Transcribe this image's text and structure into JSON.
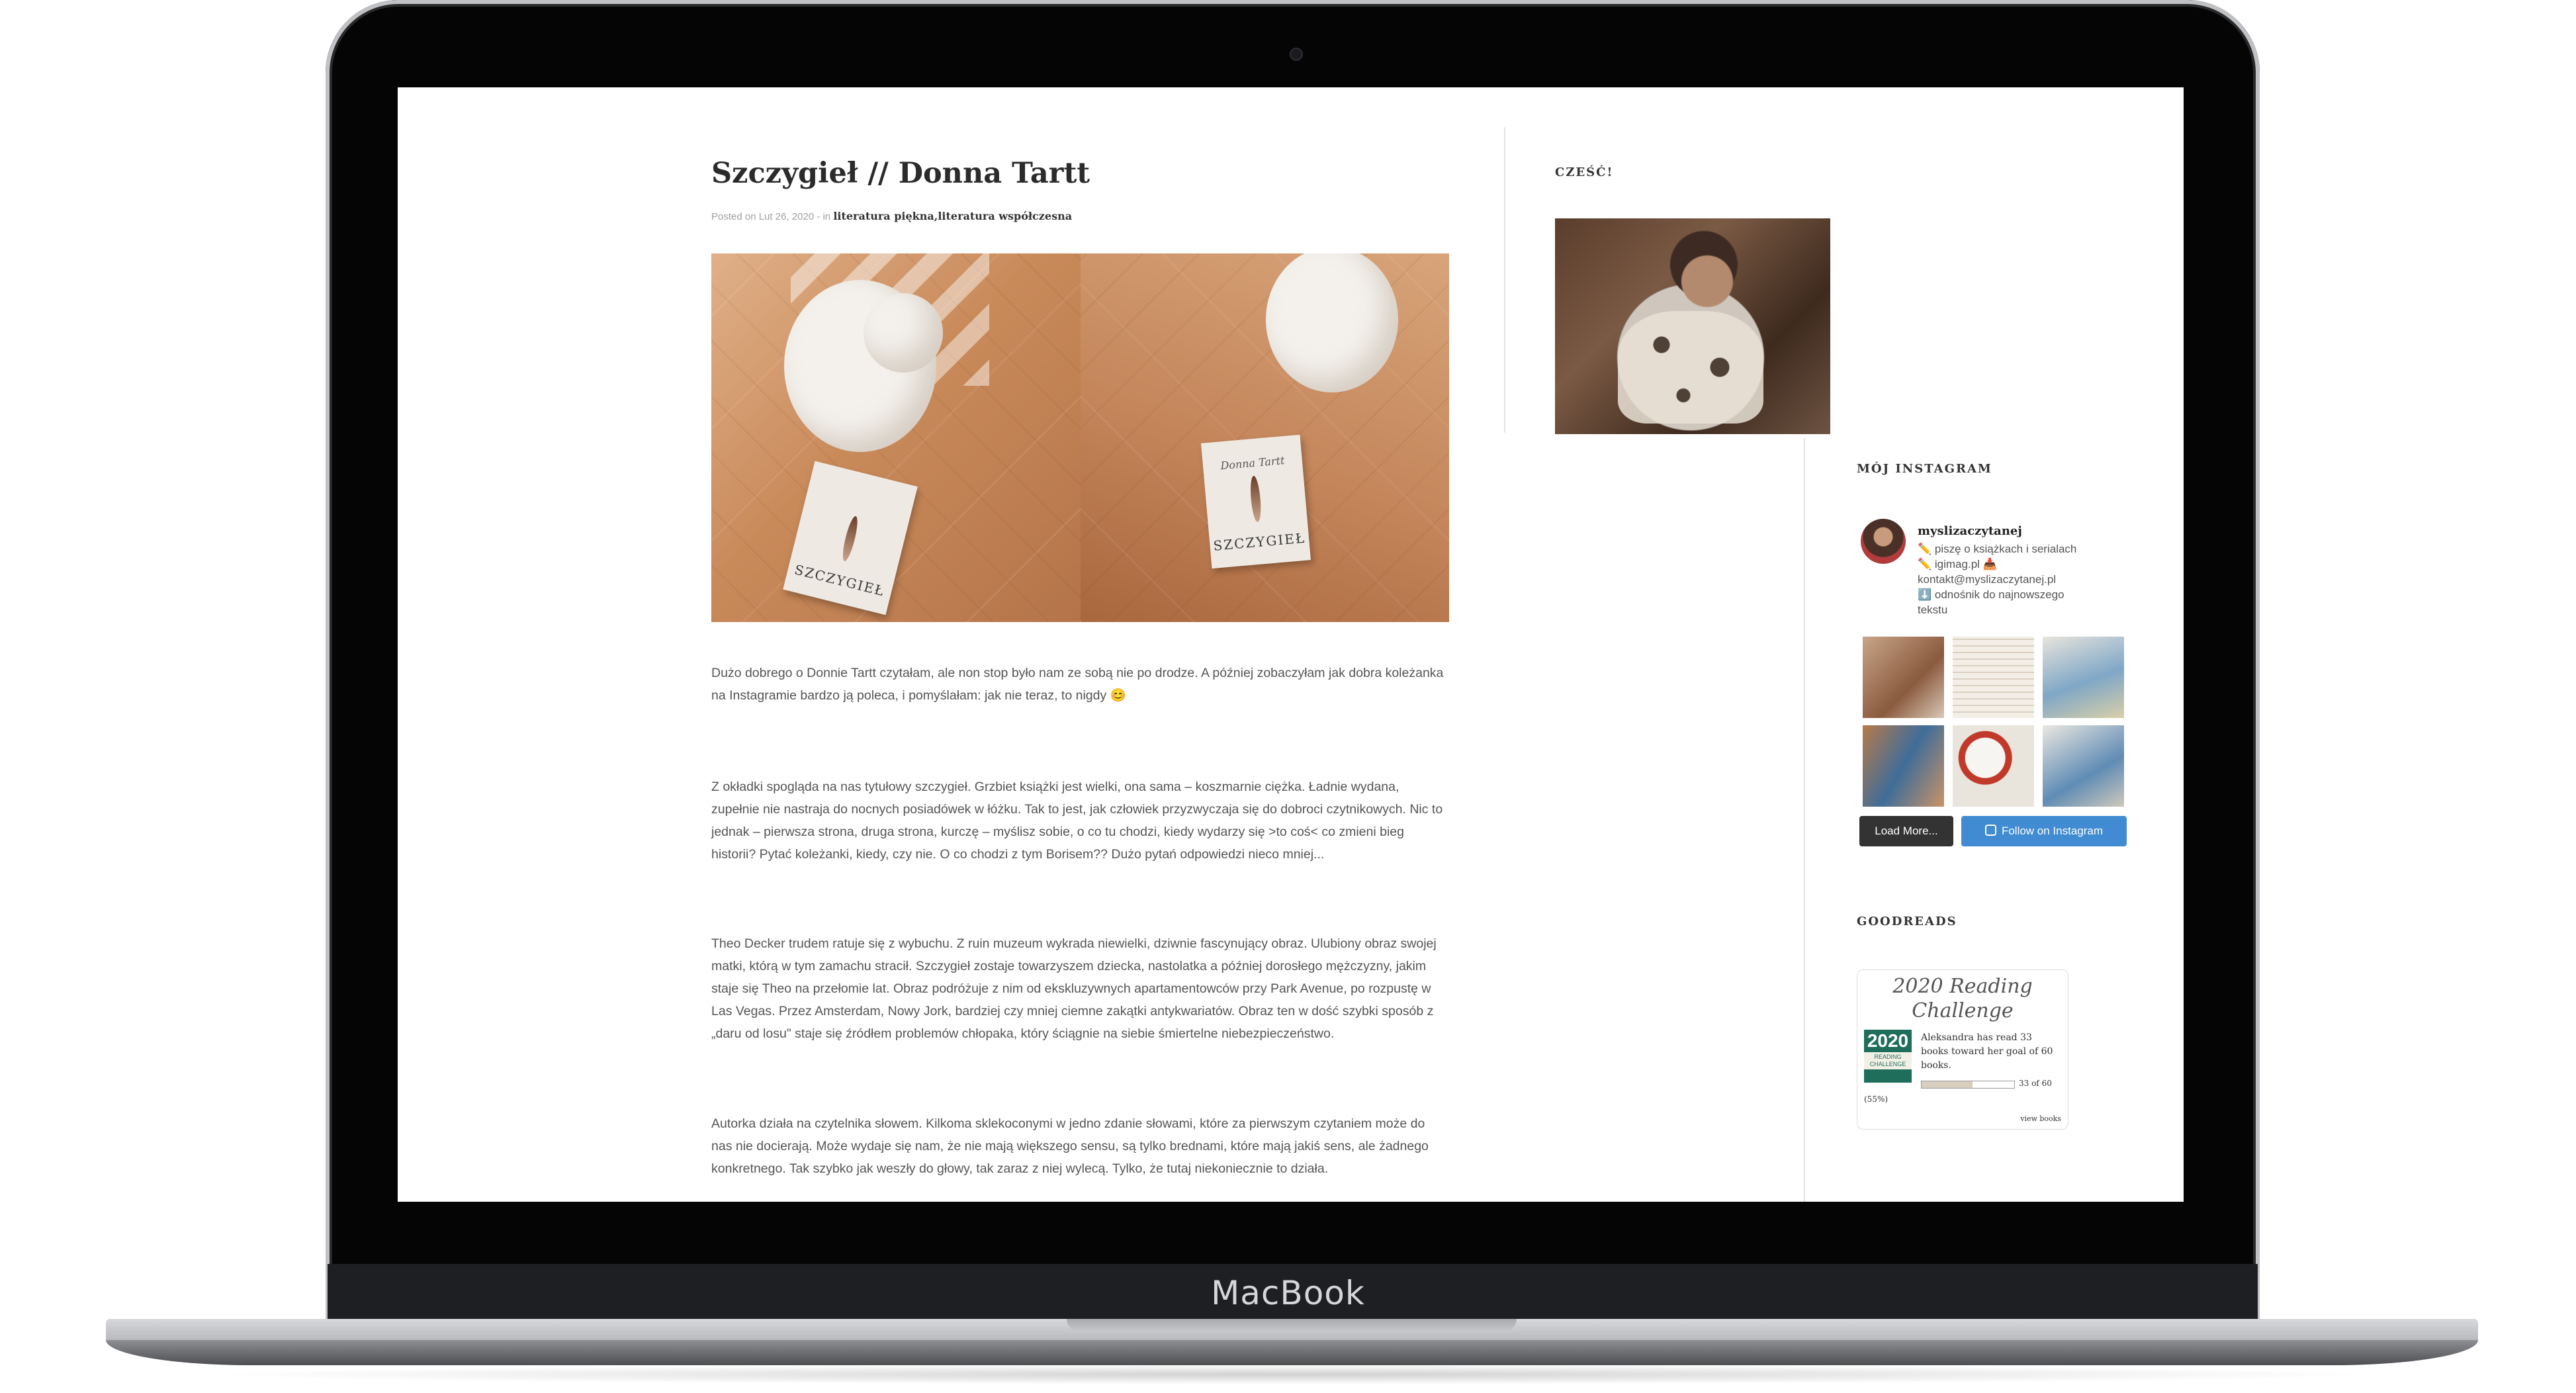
{
  "device": {
    "brand": "MacBook"
  },
  "post": {
    "title": "Szczygieł // Donna Tartt",
    "meta_prefix": "Posted on Lut 26, 2020 - in",
    "categories": [
      "literatura piękna",
      "literatura współczesna"
    ],
    "image_book_title": "SZCZYGIEŁ",
    "image_book_author": "Donna Tartt",
    "paragraphs": [
      "Dużo dobrego o Donnie Tartt czytałam, ale non stop było nam ze sobą nie po drodze. A później zobaczyłam jak dobra koleżanka na Instagramie bardzo ją poleca, i pomyślałam: jak nie teraz, to nigdy 😊",
      "Z okładki spogląda na nas tytułowy szczygieł. Grzbiet książki jest wielki, ona sama – koszmarnie ciężka. Ładnie wydana, zupełnie nie nastraja do nocnych posiadówek w łóżku. Tak to jest, jak człowiek przyzwyczaja się do dobroci czytnikowych. Nic to jednak – pierwsza strona, druga strona, kurczę – myślisz sobie, o co tu chodzi, kiedy wydarzy się >to coś< co zmieni bieg historii? Pytać koleżanki, kiedy, czy nie. O co chodzi z tym Borisem?? Dużo pytań odpowiedzi nieco mniej...",
      "Theo Decker trudem ratuje się z wybuchu. Z ruin muzeum wykrada niewielki, dziwnie fascynujący obraz. Ulubiony obraz swojej matki, którą w tym zamachu stracił. Szczygieł zostaje towarzyszem dziecka, nastolatka a później dorosłego mężczyzny, jakim staje się Theo na przełomie lat. Obraz podróżuje z nim od ekskluzywnych apartamentowców przy Park Avenue, po rozpustę w Las Vegas. Przez Amsterdam, Nowy Jork, bardziej czy mniej ciemne zakątki antykwariatów. Obraz ten w dość szybki sposób z „daru od losu\" staje się źródłem problemów chłopaka, który ściągnie na siebie śmiertelne niebezpieczeństwo.",
      "Autorka działa na czytelnika słowem. Kilkoma sklekoconymi w jedno zdanie słowami, które za pierwszym czytaniem może do nas nie docierają. Może wydaje się nam, że nie mają większego sensu, są tylko brednami, które mają jakiś sens, ale żadnego konkretnego. Tak szybko jak weszły do głowy, tak zaraz z niej wylecą. Tylko, że tutaj niekoniecznie to działa."
    ]
  },
  "sidebar": {
    "hello_heading": "CZEŚĆ!",
    "instagram": {
      "heading": "MÓJ INSTAGRAM",
      "username": "myslizaczytanej",
      "bio_lines": [
        "✏️ piszę o książkach i serialach",
        "✏️ igimag.pl 📥",
        "kontakt@myslizaczytanej.pl",
        "⬇️ odnośnik do najnowszego",
        "tekstu"
      ],
      "load_more_label": "Load More...",
      "follow_label": "Follow on Instagram",
      "load_more_color": "#333333",
      "follow_color": "#408bd1"
    },
    "goodreads": {
      "heading": "GOODREADS",
      "challenge_title": "2020 Reading Challenge",
      "badge_year": "2020",
      "badge_text": "READING CHALLENGE",
      "progress_text": "Aleksandra has read 33 books toward her goal of 60 books.",
      "count_text": "33 of 60",
      "percent_text": "(55%)",
      "progress_fraction": 0.55,
      "view_books": "view books"
    }
  }
}
